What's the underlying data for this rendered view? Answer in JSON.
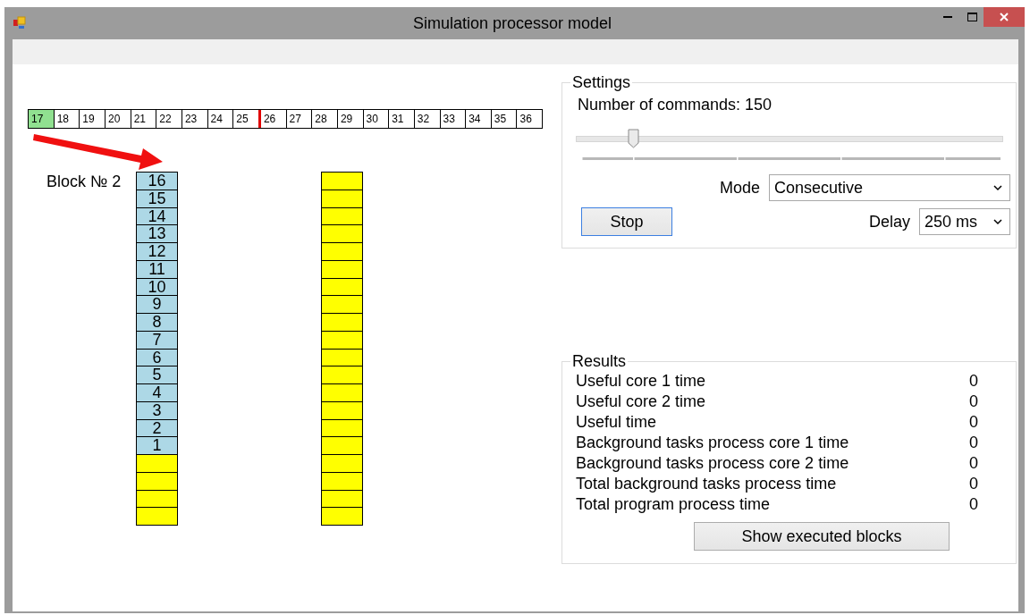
{
  "window": {
    "title": "Simulation processor model"
  },
  "tape": [
    {
      "label": "17",
      "current": true,
      "marker": false
    },
    {
      "label": "18",
      "current": false,
      "marker": false
    },
    {
      "label": "19",
      "current": false,
      "marker": false
    },
    {
      "label": "20",
      "current": false,
      "marker": false
    },
    {
      "label": "21",
      "current": false,
      "marker": false
    },
    {
      "label": "22",
      "current": false,
      "marker": false
    },
    {
      "label": "23",
      "current": false,
      "marker": false
    },
    {
      "label": "24",
      "current": false,
      "marker": false
    },
    {
      "label": "25",
      "current": false,
      "marker": false
    },
    {
      "label": "26",
      "current": false,
      "marker": true
    },
    {
      "label": "27",
      "current": false,
      "marker": false
    },
    {
      "label": "28",
      "current": false,
      "marker": false
    },
    {
      "label": "29",
      "current": false,
      "marker": false
    },
    {
      "label": "30",
      "current": false,
      "marker": false
    },
    {
      "label": "31",
      "current": false,
      "marker": false
    },
    {
      "label": "32",
      "current": false,
      "marker": false
    },
    {
      "label": "33",
      "current": false,
      "marker": false
    },
    {
      "label": "34",
      "current": false,
      "marker": false
    },
    {
      "label": "35",
      "current": false,
      "marker": false
    },
    {
      "label": "36",
      "current": false,
      "marker": false
    }
  ],
  "blocks": [
    {
      "label": "Block № 2",
      "cells": [
        {
          "kind": "command",
          "label": "16"
        },
        {
          "kind": "command",
          "label": "15"
        },
        {
          "kind": "command",
          "label": "14"
        },
        {
          "kind": "command",
          "label": "13"
        },
        {
          "kind": "command",
          "label": "12"
        },
        {
          "kind": "command",
          "label": "11"
        },
        {
          "kind": "command",
          "label": "10"
        },
        {
          "kind": "command",
          "label": "9"
        },
        {
          "kind": "command",
          "label": "8"
        },
        {
          "kind": "command",
          "label": "7"
        },
        {
          "kind": "command",
          "label": "6"
        },
        {
          "kind": "command",
          "label": "5"
        },
        {
          "kind": "command",
          "label": "4"
        },
        {
          "kind": "command",
          "label": "3"
        },
        {
          "kind": "command",
          "label": "2"
        },
        {
          "kind": "command",
          "label": "1"
        },
        {
          "kind": "empty"
        },
        {
          "kind": "empty"
        },
        {
          "kind": "empty"
        },
        {
          "kind": "empty"
        }
      ]
    },
    {
      "cells": [
        {
          "kind": "empty"
        },
        {
          "kind": "empty"
        },
        {
          "kind": "empty"
        },
        {
          "kind": "empty"
        },
        {
          "kind": "empty"
        },
        {
          "kind": "empty"
        },
        {
          "kind": "empty"
        },
        {
          "kind": "empty"
        },
        {
          "kind": "empty"
        },
        {
          "kind": "empty"
        },
        {
          "kind": "empty"
        },
        {
          "kind": "empty"
        },
        {
          "kind": "empty"
        },
        {
          "kind": "empty"
        },
        {
          "kind": "empty"
        },
        {
          "kind": "empty"
        },
        {
          "kind": "empty"
        },
        {
          "kind": "empty"
        },
        {
          "kind": "empty"
        },
        {
          "kind": "empty"
        }
      ]
    }
  ],
  "settings": {
    "title": "Settings",
    "commands_label": "Number of commands: 150",
    "slider": {
      "level": 0.134
    },
    "mode": {
      "label": "Mode",
      "value": "Consecutive"
    },
    "stop_button": "Stop",
    "delay": {
      "label": "Delay",
      "value": "250 ms"
    }
  },
  "results": {
    "title": "Results",
    "rows": [
      {
        "label": "Useful core 1 time",
        "value": "0"
      },
      {
        "label": "Useful core 2 time",
        "value": "0"
      },
      {
        "label": "Useful time",
        "value": "0"
      },
      {
        "label": "Background tasks process core 1 time",
        "value": "0"
      },
      {
        "label": "Background tasks process core 2 time",
        "value": "0"
      },
      {
        "label": "Total background tasks process time",
        "value": "0"
      },
      {
        "label": "Total program process time",
        "value": "0"
      }
    ],
    "button": "Show executed blocks"
  }
}
